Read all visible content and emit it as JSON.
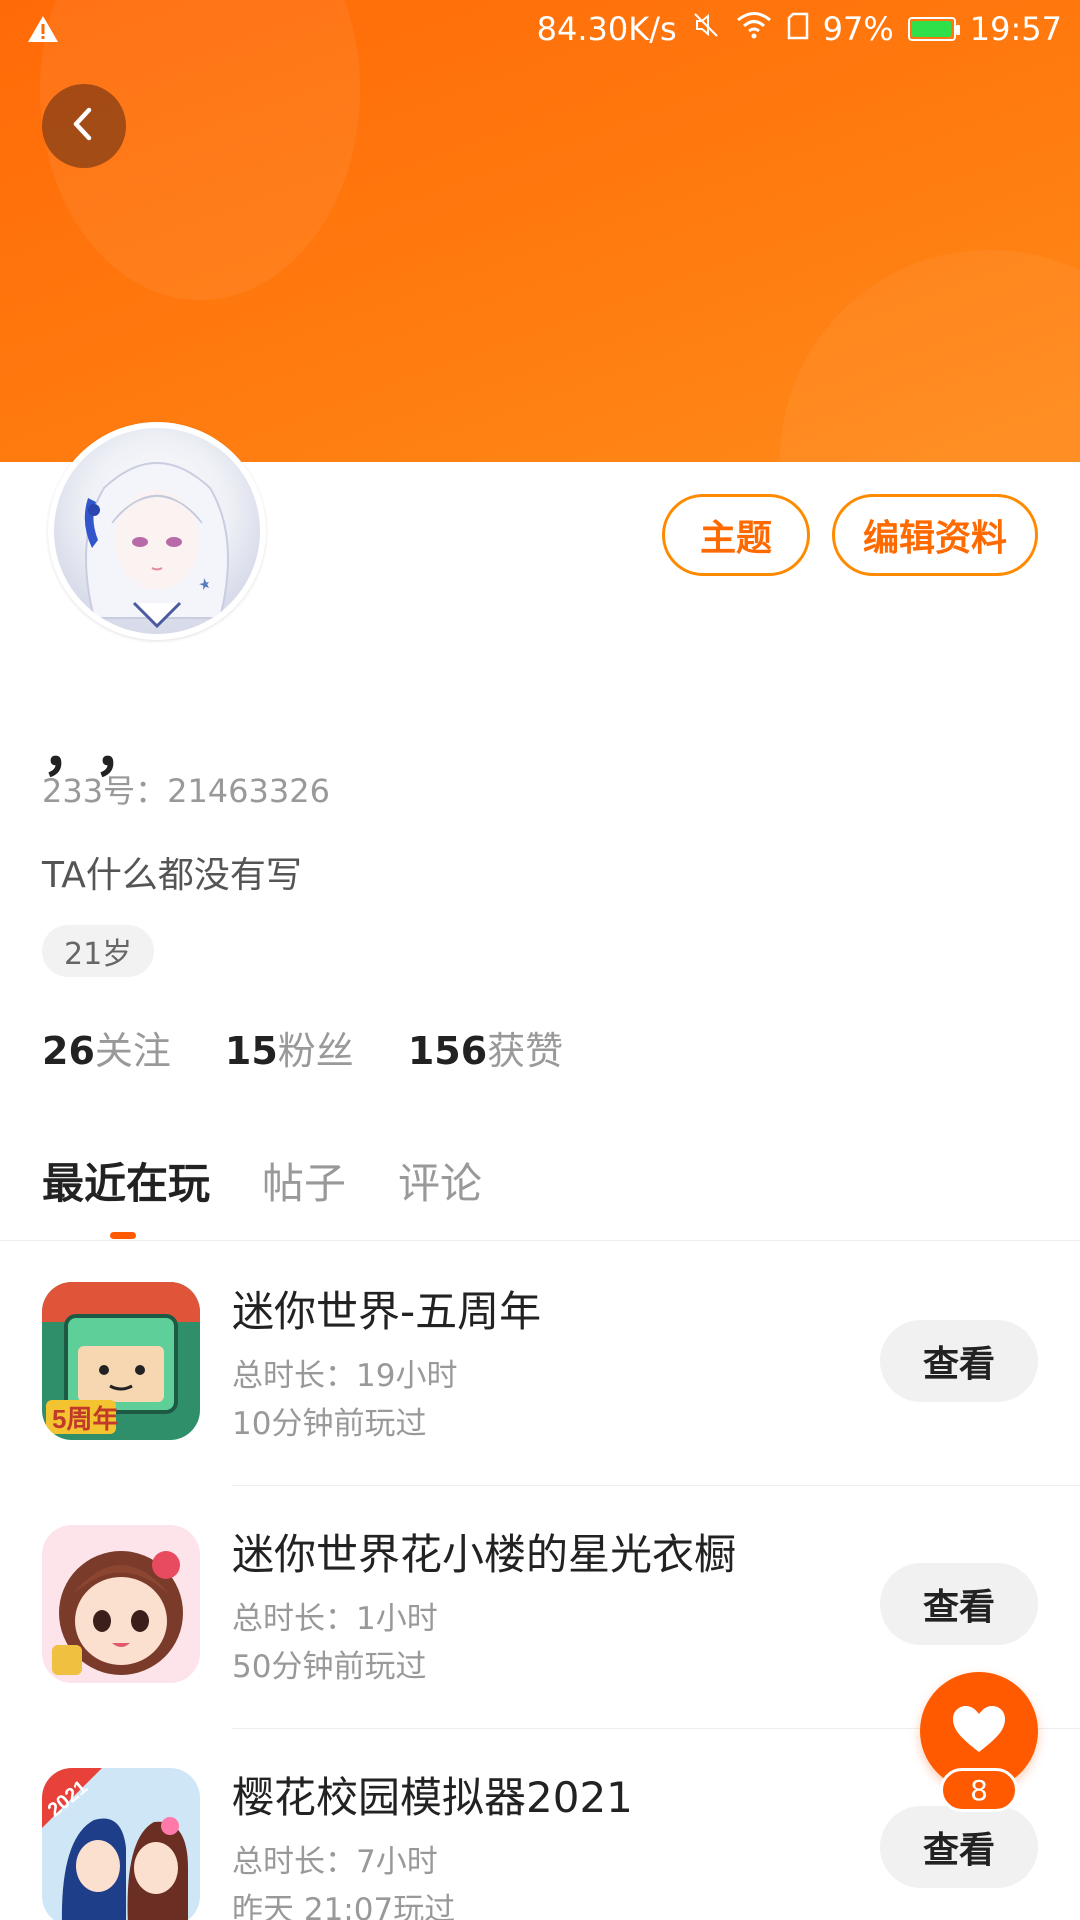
{
  "status_bar": {
    "speed": "84.30K/s",
    "battery": "97%",
    "battery_fraction": 0.97,
    "time": "19:57",
    "icons": [
      "warning-icon",
      "mute-icon",
      "wifi-icon",
      "sim-icon",
      "battery-icon"
    ]
  },
  "header": {
    "back_icon": "chevron-left-icon"
  },
  "profile": {
    "avatar": "anime-girl-avatar",
    "buttons": {
      "theme": "主题",
      "edit": "编辑资料"
    },
    "nickname": "，，",
    "uid": "233号：21463326",
    "bio": "TA什么都没有写",
    "age": "21岁",
    "stats": [
      {
        "num": "26",
        "label": "关注"
      },
      {
        "num": "15",
        "label": "粉丝"
      },
      {
        "num": "156",
        "label": "获赞"
      }
    ]
  },
  "tabs": [
    {
      "label": "最近在玩",
      "active": true
    },
    {
      "label": "帖子",
      "active": false
    },
    {
      "label": "评论",
      "active": false
    }
  ],
  "games": [
    {
      "name": "迷你世界-五周年",
      "duration": "总时长：19小时",
      "last_played": "10分钟前玩过",
      "button": "查看",
      "icon": "mini-world-icon"
    },
    {
      "name": "迷你世界花小楼的星光衣橱",
      "duration": "总时长：1小时",
      "last_played": "50分钟前玩过",
      "button": "查看",
      "icon": "mini-world-wardrobe-icon"
    },
    {
      "name": "樱花校园模拟器2021",
      "duration": "总时长：7小时",
      "last_played": "昨天 21:07玩过",
      "button": "查看",
      "icon": "sakura-school-icon"
    }
  ],
  "fab": {
    "icon": "heart-icon",
    "count": "8"
  },
  "colors": {
    "accent": "#ff5a00",
    "header": "#ff7b0f",
    "outline": "#ff8a00"
  }
}
